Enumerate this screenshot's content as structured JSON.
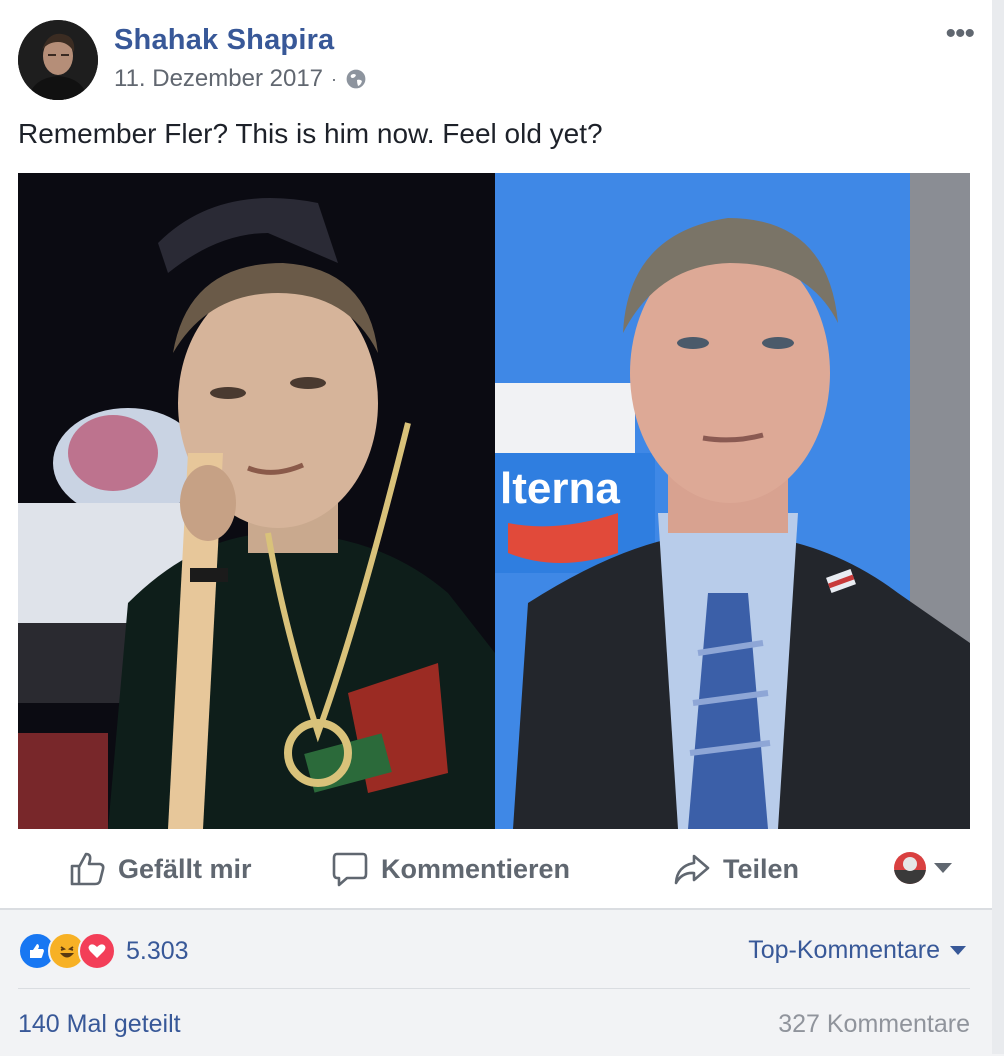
{
  "post": {
    "author": "Shahak Shapira",
    "date": "11. Dezember 2017",
    "separator": "·",
    "privacy_icon": "globe-icon",
    "more_label": "•••",
    "text": "Remember Fler? This is him now. Feel old yet?",
    "photo_panels": {
      "left": {
        "dominant_color": "#0b0b12"
      },
      "right": {
        "dominant_color": "#3f88e6",
        "sign_text": "lterna"
      }
    }
  },
  "actions": {
    "like": {
      "label": "Gefällt mir",
      "icon": "thumbs-up-icon"
    },
    "comment": {
      "label": "Kommentieren",
      "icon": "comment-icon"
    },
    "share": {
      "label": "Teilen",
      "icon": "share-icon"
    }
  },
  "stats": {
    "reaction_icons": [
      "like-reaction-icon",
      "haha-reaction-icon",
      "love-reaction-icon"
    ],
    "reaction_count": "5.303",
    "sort_label": "Top-Kommentare",
    "shares_label": "140 Mal geteilt",
    "comments_label": "327 Kommentare"
  },
  "colors": {
    "link_blue": "#385898",
    "like_blue": "#1877f2",
    "love_red": "#f33e58",
    "haha_yellow": "#f7b125",
    "muted_gray": "#606770",
    "footer_bg": "#f2f3f5"
  }
}
